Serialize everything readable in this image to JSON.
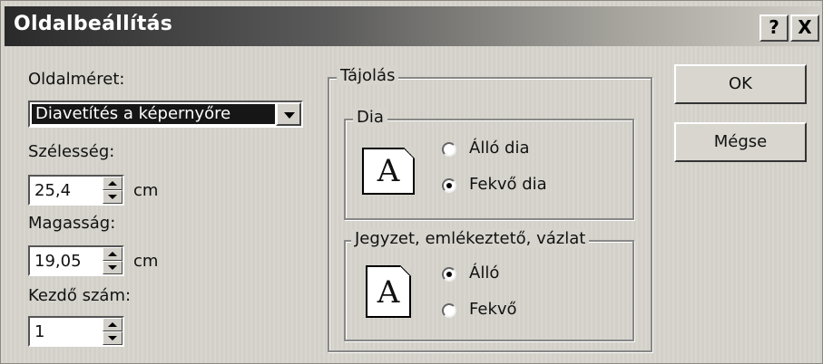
{
  "window": {
    "title": "Oldalbeállítás",
    "help_button": "?",
    "close_button": "X"
  },
  "left": {
    "page_size_label": "Oldalméret:",
    "page_size_value": "Diavetítés a képernyőre",
    "width_label": "Szélesség:",
    "width_value": "25,4",
    "width_unit": "cm",
    "height_label": "Magasság:",
    "height_value": "19,05",
    "height_unit": "cm",
    "start_number_label": "Kezdő szám:",
    "start_number_value": "1"
  },
  "orientation": {
    "label": "Tájolás",
    "slides": {
      "label": "Dia",
      "icon_letter": "A",
      "options": [
        "Álló dia",
        "Fekvő dia"
      ],
      "selected": "Fekvő dia"
    },
    "notes": {
      "label": "Jegyzet, emlékeztető, vázlat",
      "icon_letter": "A",
      "options": [
        "Álló",
        "Fekvő"
      ],
      "selected": "Álló"
    }
  },
  "buttons": {
    "ok": "OK",
    "cancel": "Mégse"
  }
}
